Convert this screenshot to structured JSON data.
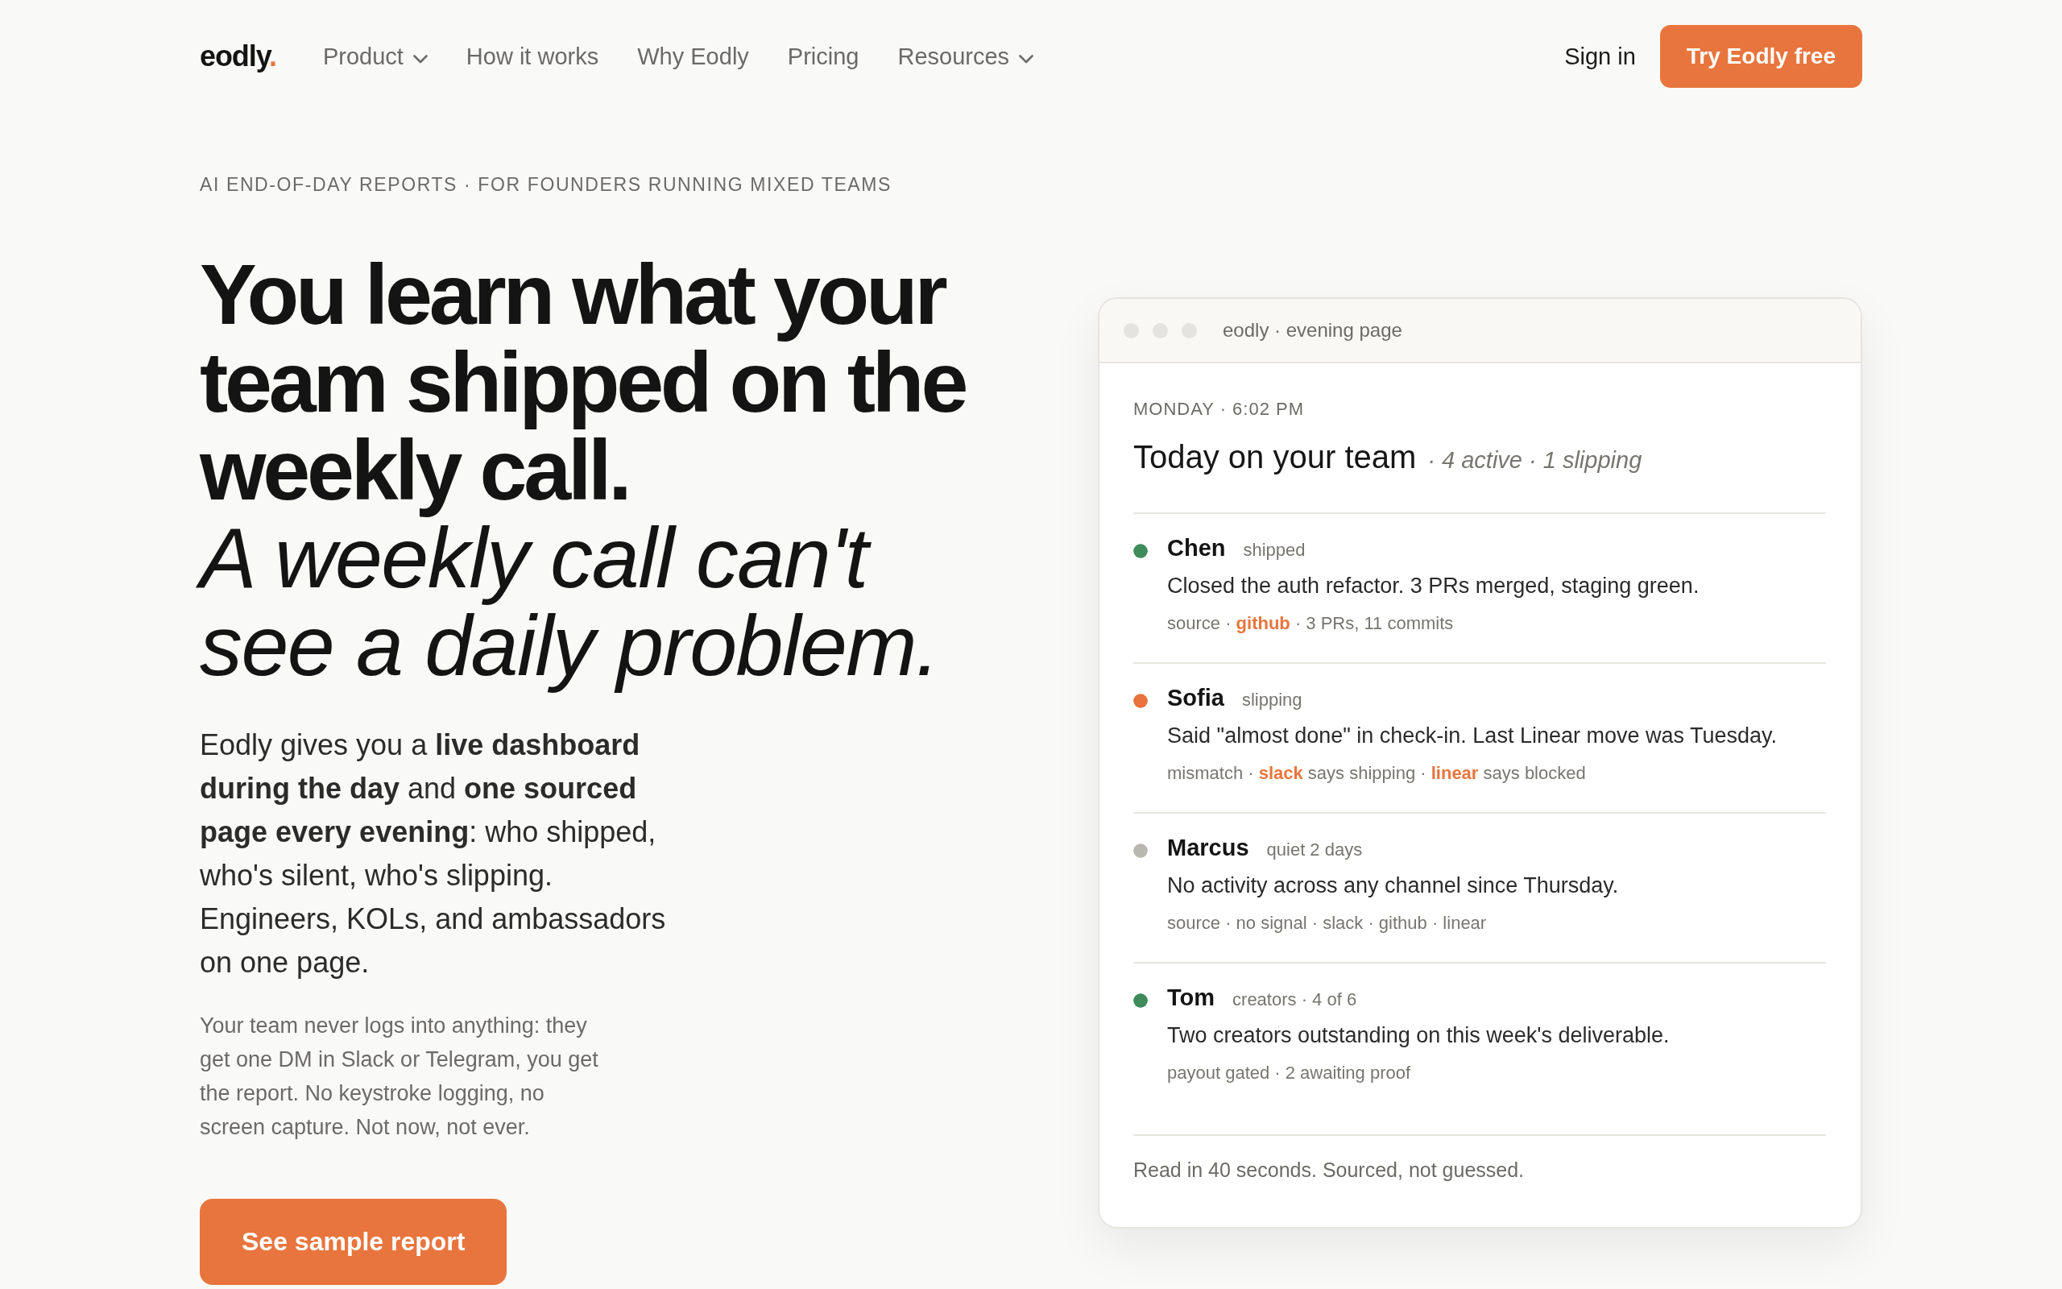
{
  "nav": {
    "logo": {
      "name": "eodly",
      "mark": "."
    },
    "links": [
      {
        "label": "Product",
        "has_menu": true
      },
      {
        "label": "How it works",
        "has_menu": false
      },
      {
        "label": "Why Eodly",
        "has_menu": false
      },
      {
        "label": "Pricing",
        "has_menu": false
      },
      {
        "label": "Resources",
        "has_menu": true
      }
    ],
    "sign_in": "Sign in",
    "cta": "Try Eodly free"
  },
  "hero": {
    "eyebrow": "AI END-OF-DAY REPORTS · FOR FOUNDERS RUNNING MIXED TEAMS",
    "headline": "You learn what your team shipped on the weekly call.",
    "headline_italic": "A weekly call can't see a daily problem.",
    "lead": "Eodly gives you a **live dashboard during the day** and **one sourced page every evening**: who shipped, who's silent, who's slipping. Engineers, KOLs, and ambassadors on one page.",
    "note": "Your team never logs into anything: they get one DM in Slack or Telegram, you get the report. No keystroke logging, no screen capture. Not now, not ever.",
    "button": "See sample report"
  },
  "report_window": {
    "title": "eodly · evening page",
    "date": "MONDAY · 6:02 PM",
    "heading": "Today on your team",
    "summary": "· 4 active · 1 slipping",
    "members": [
      {
        "name": "Chen",
        "status": "shipped",
        "color": "#3d8c5a",
        "activity": "Closed the auth refactor. 3 PRs merged, staging green.",
        "sources": "source · **github** · 3 PRs, 11 commits"
      },
      {
        "name": "Sofia",
        "status": "slipping",
        "color": "#e8733c",
        "activity": "Said \"almost done\" in check-in. Last Linear move was Tuesday.",
        "sources": "mismatch · **slack** says shipping · **linear** says blocked"
      },
      {
        "name": "Marcus",
        "status": "quiet 2 days",
        "color": "#b8b7b0",
        "activity": "No activity across any channel since Thursday.",
        "sources": "source · no signal · slack · github · linear"
      },
      {
        "name": "Tom",
        "status": "creators · 4 of 6",
        "color": "#3d8c5a",
        "activity": "Two creators outstanding on this week's deliverable.",
        "sources": "payout gated · 2 awaiting proof"
      }
    ],
    "footer": "Read in 40 seconds. Sourced, not guessed."
  }
}
